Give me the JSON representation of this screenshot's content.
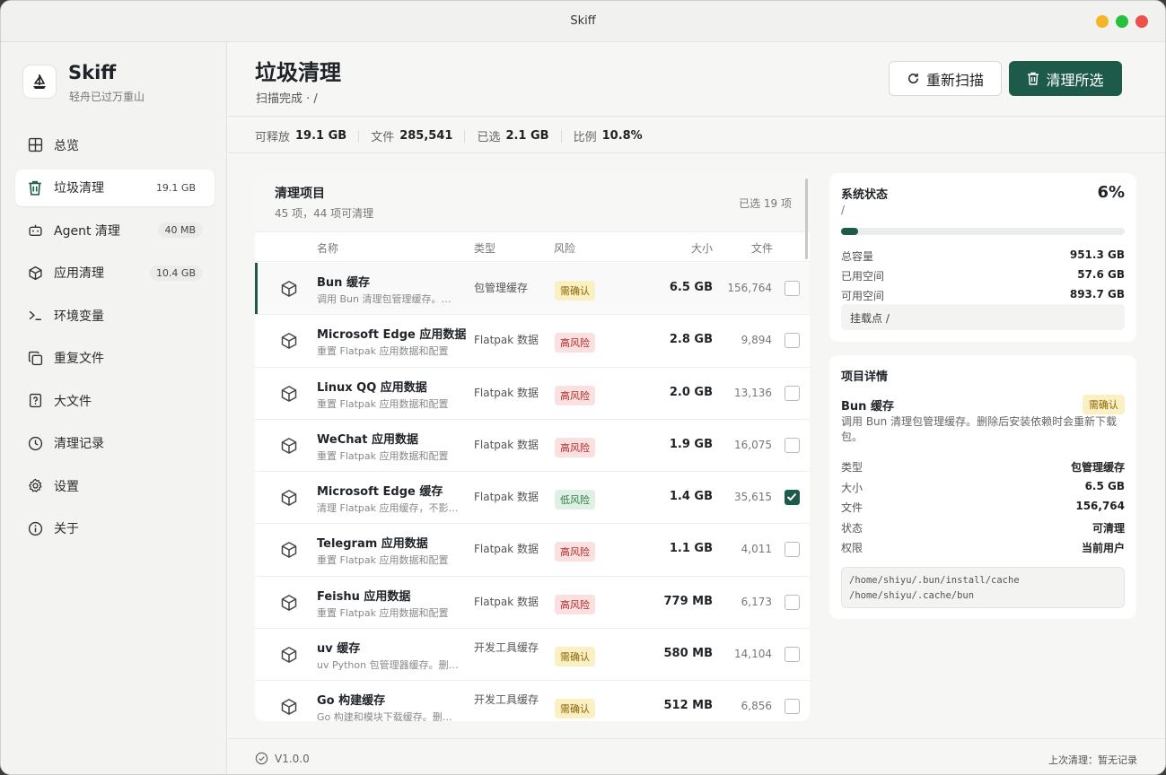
{
  "window": {
    "title": "Skiff"
  },
  "brand": {
    "name": "Skiff",
    "tagline": "轻舟已过万重山"
  },
  "nav": [
    {
      "label": "总览",
      "icon": "grid-icon",
      "badge": ""
    },
    {
      "label": "垃圾清理",
      "icon": "trash-icon",
      "badge": "19.1 GB",
      "active": true
    },
    {
      "label": "Agent 清理",
      "icon": "robot-icon",
      "badge": "40 MB"
    },
    {
      "label": "应用清理",
      "icon": "package-icon",
      "badge": "10.4 GB"
    },
    {
      "label": "环境变量",
      "icon": "terminal-icon",
      "badge": ""
    },
    {
      "label": "重复文件",
      "icon": "copy-icon",
      "badge": ""
    },
    {
      "label": "大文件",
      "icon": "file-question-icon",
      "badge": ""
    },
    {
      "label": "清理记录",
      "icon": "clock-icon",
      "badge": ""
    },
    {
      "label": "设置",
      "icon": "gear-icon",
      "badge": ""
    },
    {
      "label": "关于",
      "icon": "info-icon",
      "badge": ""
    }
  ],
  "page": {
    "title": "垃圾清理",
    "subtitle": "扫描完成 · /"
  },
  "actions": {
    "rescan": "重新扫描",
    "clean_selected": "清理所选"
  },
  "stats": {
    "releasable_label": "可释放",
    "releasable": "19.1 GB",
    "files_label": "文件",
    "files": "285,541",
    "selected_label": "已选",
    "selected": "2.1 GB",
    "ratio_label": "比例",
    "ratio": "10.8%"
  },
  "list": {
    "title": "清理项目",
    "subtitle": "45 项，44 项可清理",
    "selected_count": "已选 19 项",
    "columns": {
      "name": "名称",
      "type": "类型",
      "risk": "风险",
      "size": "大小",
      "files": "文件"
    },
    "rows": [
      {
        "name": "Bun 缓存",
        "desc": "调用 Bun 清理包管理缓存。删除后安装依赖时会重新下载包。",
        "type": "包管理缓存",
        "risk": "需确认",
        "risk_level": "confirm",
        "size": "6.5 GB",
        "files": "156,764",
        "checked": false,
        "selected": true
      },
      {
        "name": "Microsoft Edge 应用数据",
        "desc": "重置 Flatpak 应用数据和配置",
        "type": "Flatpak 数据",
        "risk": "高风险",
        "risk_level": "high",
        "size": "2.8 GB",
        "files": "9,894",
        "checked": false
      },
      {
        "name": "Linux QQ 应用数据",
        "desc": "重置 Flatpak 应用数据和配置",
        "type": "Flatpak 数据",
        "risk": "高风险",
        "risk_level": "high",
        "size": "2.0 GB",
        "files": "13,136",
        "checked": false
      },
      {
        "name": "WeChat 应用数据",
        "desc": "重置 Flatpak 应用数据和配置",
        "type": "Flatpak 数据",
        "risk": "高风险",
        "risk_level": "high",
        "size": "1.9 GB",
        "files": "16,075",
        "checked": false
      },
      {
        "name": "Microsoft Edge 缓存",
        "desc": "清理 Flatpak 应用缓存，不影响数据",
        "type": "Flatpak 数据",
        "risk": "低风险",
        "risk_level": "low",
        "size": "1.4 GB",
        "files": "35,615",
        "checked": true
      },
      {
        "name": "Telegram 应用数据",
        "desc": "重置 Flatpak 应用数据和配置",
        "type": "Flatpak 数据",
        "risk": "高风险",
        "risk_level": "high",
        "size": "1.1 GB",
        "files": "4,011",
        "checked": false
      },
      {
        "name": "Feishu 应用数据",
        "desc": "重置 Flatpak 应用数据和配置",
        "type": "Flatpak 数据",
        "risk": "高风险",
        "risk_level": "high",
        "size": "779 MB",
        "files": "6,173",
        "checked": false
      },
      {
        "name": "uv 缓存",
        "desc": "uv Python 包管理器缓存。删除后会重新下载",
        "type": "开发工具缓存",
        "risk": "需确认",
        "risk_level": "confirm",
        "size": "580 MB",
        "files": "14,104",
        "checked": false
      },
      {
        "name": "Go 构建缓存",
        "desc": "Go 构建和模块下载缓存。删除后会重新构建",
        "type": "开发工具缓存",
        "risk": "需确认",
        "risk_level": "confirm",
        "size": "512 MB",
        "files": "6,856",
        "checked": false
      }
    ]
  },
  "system": {
    "title": "系统状态",
    "percent": "6%",
    "usage_fraction": 0.06,
    "mount_short": "/",
    "total_label": "总容量",
    "total": "951.3 GB",
    "used_label": "已用空间",
    "used": "57.6 GB",
    "free_label": "可用空间",
    "free": "893.7 GB",
    "mount_point": "挂载点 /"
  },
  "detail": {
    "title": "项目详情",
    "name": "Bun 缓存",
    "risk": "需确认",
    "desc": "调用 Bun 清理包管理缓存。删除后安装依赖时会重新下载包。",
    "type_label": "类型",
    "type": "包管理缓存",
    "size_label": "大小",
    "size": "6.5 GB",
    "files_label": "文件",
    "files": "156,764",
    "status_label": "状态",
    "status": "可清理",
    "perm_label": "权限",
    "perm": "当前用户",
    "paths": [
      "/home/shiyu/.bun/install/cache",
      "/home/shiyu/.cache/bun"
    ]
  },
  "footer": {
    "version": "V1.0.0",
    "last_clean": "上次清理：暂无记录"
  },
  "colors": {
    "accent": "#1e5a4a",
    "traffic_min": "#f4b526",
    "traffic_max": "#27c13b",
    "traffic_close": "#f0504a"
  }
}
